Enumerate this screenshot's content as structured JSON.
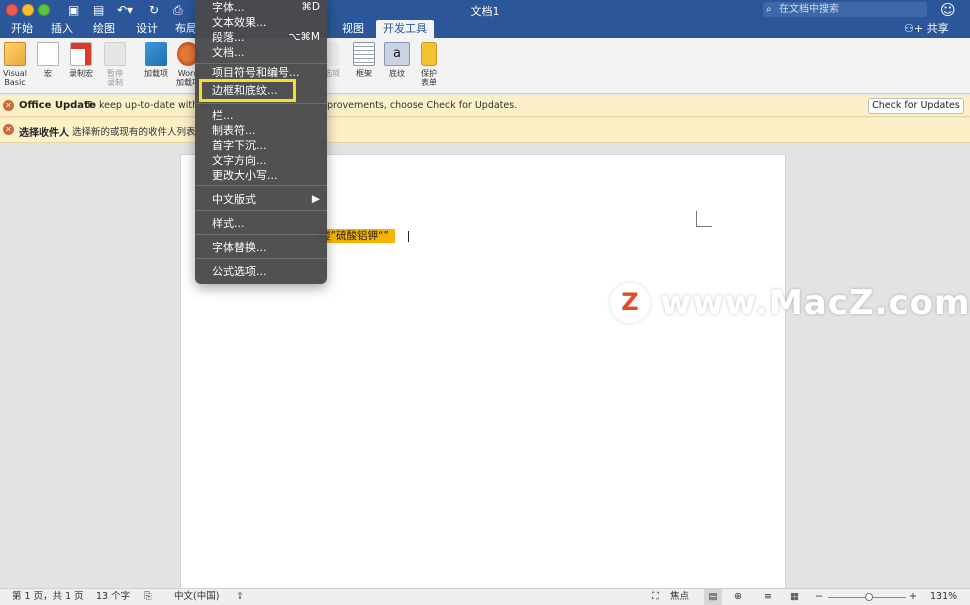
{
  "titlebar": {
    "doc_title": "文档1",
    "search_placeholder": "在文档中搜索"
  },
  "tabs": [
    {
      "label": "开始",
      "active": false
    },
    {
      "label": "插入",
      "active": false
    },
    {
      "label": "绘图",
      "active": false
    },
    {
      "label": "设计",
      "active": false
    },
    {
      "label": "布局",
      "active": false
    },
    {
      "label": "视图",
      "active": false
    },
    {
      "label": "开发工具",
      "active": true
    }
  ],
  "share_label": "共享",
  "ribbon": {
    "visual_basic": "Visual\nBasic",
    "macros": "宏",
    "record_macro": "录制宏",
    "pause_recording": "暂停\n录制",
    "addins": "加载项",
    "word_addins": "Word\n加载项",
    "partial_label": "选项",
    "frame": "框架",
    "shading": "底纹",
    "protect_form": "保护\n表单"
  },
  "messages": {
    "update_title": "Office Update",
    "update_text_left": "To keep up-to-date with se",
    "update_text_right": "provements, choose Check for Updates.",
    "check_updates_button": "Check for Updates",
    "recipients_title": "选择收件人",
    "recipients_text": "选择新的或现有的收件人列表"
  },
  "document": {
    "highlighted_text": "楼”硫酸铝钾“”"
  },
  "watermark": {
    "logo_letter": "Z",
    "text": "www.MacZ.com"
  },
  "menu": {
    "items": [
      {
        "label": "字体...",
        "shortcut": "⌘D"
      },
      {
        "label": "文本效果...",
        "shortcut": ""
      },
      {
        "label": "段落...",
        "shortcut": "⌥⌘M"
      },
      {
        "label": "文档...",
        "shortcut": ""
      },
      {
        "label": "项目符号和编号...",
        "shortcut": ""
      },
      {
        "label": "边框和底纹...",
        "shortcut": "",
        "highlighted": true
      },
      {
        "label": "栏...",
        "shortcut": ""
      },
      {
        "label": "制表符...",
        "shortcut": ""
      },
      {
        "label": "首字下沉...",
        "shortcut": ""
      },
      {
        "label": "文字方向...",
        "shortcut": ""
      },
      {
        "label": "更改大小写...",
        "shortcut": ""
      },
      {
        "label": "中文版式",
        "shortcut": "▶"
      },
      {
        "label": "样式...",
        "shortcut": ""
      },
      {
        "label": "字体替换...",
        "shortcut": ""
      },
      {
        "label": "公式选项...",
        "shortcut": ""
      }
    ]
  },
  "status": {
    "page_count": "第 1 页，共 1 页",
    "word_count": "13 个字",
    "language": "中文(中国)",
    "focus": "焦点",
    "zoom": "131%",
    "zoom_minus": "−",
    "zoom_plus": "+"
  },
  "colors": {
    "brand_blue": "#2b579a",
    "highlight": "#f5b400",
    "callout_box": "#f0e128",
    "message_bar": "#fbf0c8"
  },
  "zoom_level_fraction": 0.53
}
